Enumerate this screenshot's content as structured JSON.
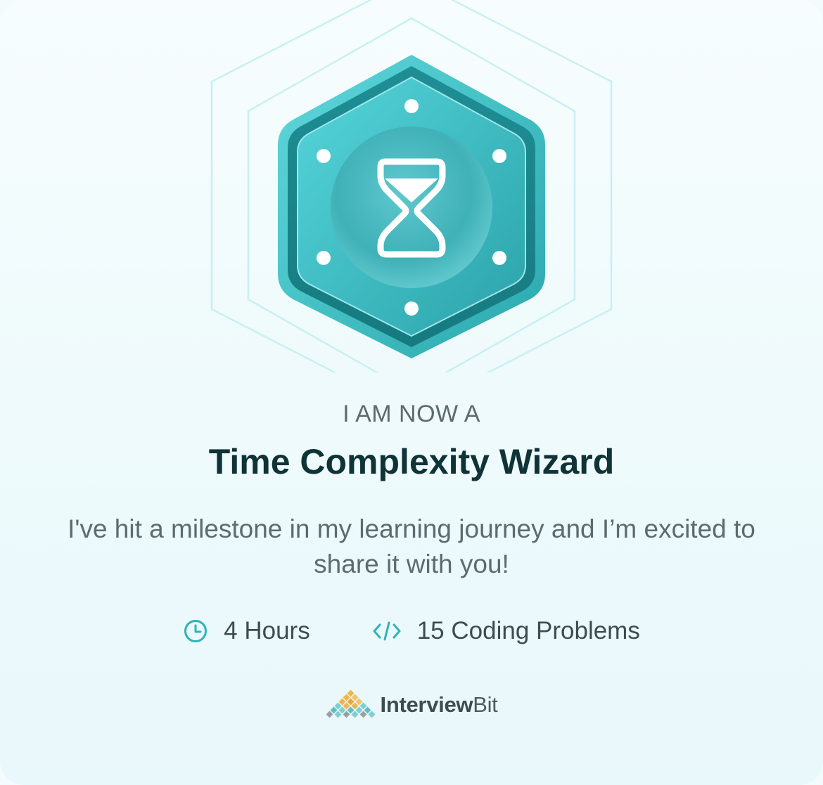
{
  "certificate": {
    "eyebrow": "I AM NOW A",
    "title": "Time Complexity Wizard",
    "description": "I've hit a milestone in my learning journey and I’m excited to share it with you!",
    "stats": [
      {
        "icon": "clock-icon",
        "label": "4 Hours"
      },
      {
        "icon": "code-icon",
        "label": "15 Coding Problems"
      }
    ],
    "badge_icon": "hourglass-icon"
  },
  "brand": {
    "name_bold": "Interview",
    "name_regular": "Bit"
  },
  "colors": {
    "accent": "#2fb3b8",
    "badge_dark": "#1f8f94",
    "title": "#0f3336",
    "text": "#5b6b6f"
  }
}
